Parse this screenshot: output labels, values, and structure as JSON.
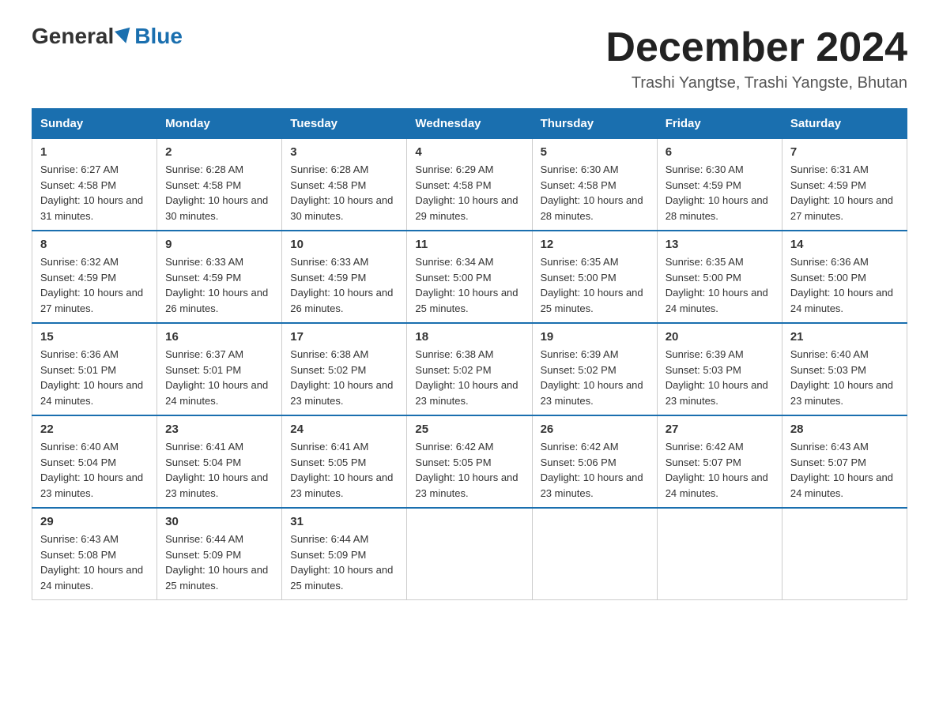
{
  "header": {
    "logo_general": "General",
    "logo_blue": "Blue",
    "main_title": "December 2024",
    "subtitle": "Trashi Yangtse, Trashi Yangste, Bhutan"
  },
  "calendar": {
    "days_of_week": [
      "Sunday",
      "Monday",
      "Tuesday",
      "Wednesday",
      "Thursday",
      "Friday",
      "Saturday"
    ],
    "weeks": [
      [
        {
          "day": "1",
          "sunrise": "6:27 AM",
          "sunset": "4:58 PM",
          "daylight": "10 hours and 31 minutes."
        },
        {
          "day": "2",
          "sunrise": "6:28 AM",
          "sunset": "4:58 PM",
          "daylight": "10 hours and 30 minutes."
        },
        {
          "day": "3",
          "sunrise": "6:28 AM",
          "sunset": "4:58 PM",
          "daylight": "10 hours and 30 minutes."
        },
        {
          "day": "4",
          "sunrise": "6:29 AM",
          "sunset": "4:58 PM",
          "daylight": "10 hours and 29 minutes."
        },
        {
          "day": "5",
          "sunrise": "6:30 AM",
          "sunset": "4:58 PM",
          "daylight": "10 hours and 28 minutes."
        },
        {
          "day": "6",
          "sunrise": "6:30 AM",
          "sunset": "4:59 PM",
          "daylight": "10 hours and 28 minutes."
        },
        {
          "day": "7",
          "sunrise": "6:31 AM",
          "sunset": "4:59 PM",
          "daylight": "10 hours and 27 minutes."
        }
      ],
      [
        {
          "day": "8",
          "sunrise": "6:32 AM",
          "sunset": "4:59 PM",
          "daylight": "10 hours and 27 minutes."
        },
        {
          "day": "9",
          "sunrise": "6:33 AM",
          "sunset": "4:59 PM",
          "daylight": "10 hours and 26 minutes."
        },
        {
          "day": "10",
          "sunrise": "6:33 AM",
          "sunset": "4:59 PM",
          "daylight": "10 hours and 26 minutes."
        },
        {
          "day": "11",
          "sunrise": "6:34 AM",
          "sunset": "5:00 PM",
          "daylight": "10 hours and 25 minutes."
        },
        {
          "day": "12",
          "sunrise": "6:35 AM",
          "sunset": "5:00 PM",
          "daylight": "10 hours and 25 minutes."
        },
        {
          "day": "13",
          "sunrise": "6:35 AM",
          "sunset": "5:00 PM",
          "daylight": "10 hours and 24 minutes."
        },
        {
          "day": "14",
          "sunrise": "6:36 AM",
          "sunset": "5:00 PM",
          "daylight": "10 hours and 24 minutes."
        }
      ],
      [
        {
          "day": "15",
          "sunrise": "6:36 AM",
          "sunset": "5:01 PM",
          "daylight": "10 hours and 24 minutes."
        },
        {
          "day": "16",
          "sunrise": "6:37 AM",
          "sunset": "5:01 PM",
          "daylight": "10 hours and 24 minutes."
        },
        {
          "day": "17",
          "sunrise": "6:38 AM",
          "sunset": "5:02 PM",
          "daylight": "10 hours and 23 minutes."
        },
        {
          "day": "18",
          "sunrise": "6:38 AM",
          "sunset": "5:02 PM",
          "daylight": "10 hours and 23 minutes."
        },
        {
          "day": "19",
          "sunrise": "6:39 AM",
          "sunset": "5:02 PM",
          "daylight": "10 hours and 23 minutes."
        },
        {
          "day": "20",
          "sunrise": "6:39 AM",
          "sunset": "5:03 PM",
          "daylight": "10 hours and 23 minutes."
        },
        {
          "day": "21",
          "sunrise": "6:40 AM",
          "sunset": "5:03 PM",
          "daylight": "10 hours and 23 minutes."
        }
      ],
      [
        {
          "day": "22",
          "sunrise": "6:40 AM",
          "sunset": "5:04 PM",
          "daylight": "10 hours and 23 minutes."
        },
        {
          "day": "23",
          "sunrise": "6:41 AM",
          "sunset": "5:04 PM",
          "daylight": "10 hours and 23 minutes."
        },
        {
          "day": "24",
          "sunrise": "6:41 AM",
          "sunset": "5:05 PM",
          "daylight": "10 hours and 23 minutes."
        },
        {
          "day": "25",
          "sunrise": "6:42 AM",
          "sunset": "5:05 PM",
          "daylight": "10 hours and 23 minutes."
        },
        {
          "day": "26",
          "sunrise": "6:42 AM",
          "sunset": "5:06 PM",
          "daylight": "10 hours and 23 minutes."
        },
        {
          "day": "27",
          "sunrise": "6:42 AM",
          "sunset": "5:07 PM",
          "daylight": "10 hours and 24 minutes."
        },
        {
          "day": "28",
          "sunrise": "6:43 AM",
          "sunset": "5:07 PM",
          "daylight": "10 hours and 24 minutes."
        }
      ],
      [
        {
          "day": "29",
          "sunrise": "6:43 AM",
          "sunset": "5:08 PM",
          "daylight": "10 hours and 24 minutes."
        },
        {
          "day": "30",
          "sunrise": "6:44 AM",
          "sunset": "5:09 PM",
          "daylight": "10 hours and 25 minutes."
        },
        {
          "day": "31",
          "sunrise": "6:44 AM",
          "sunset": "5:09 PM",
          "daylight": "10 hours and 25 minutes."
        },
        null,
        null,
        null,
        null
      ]
    ]
  }
}
